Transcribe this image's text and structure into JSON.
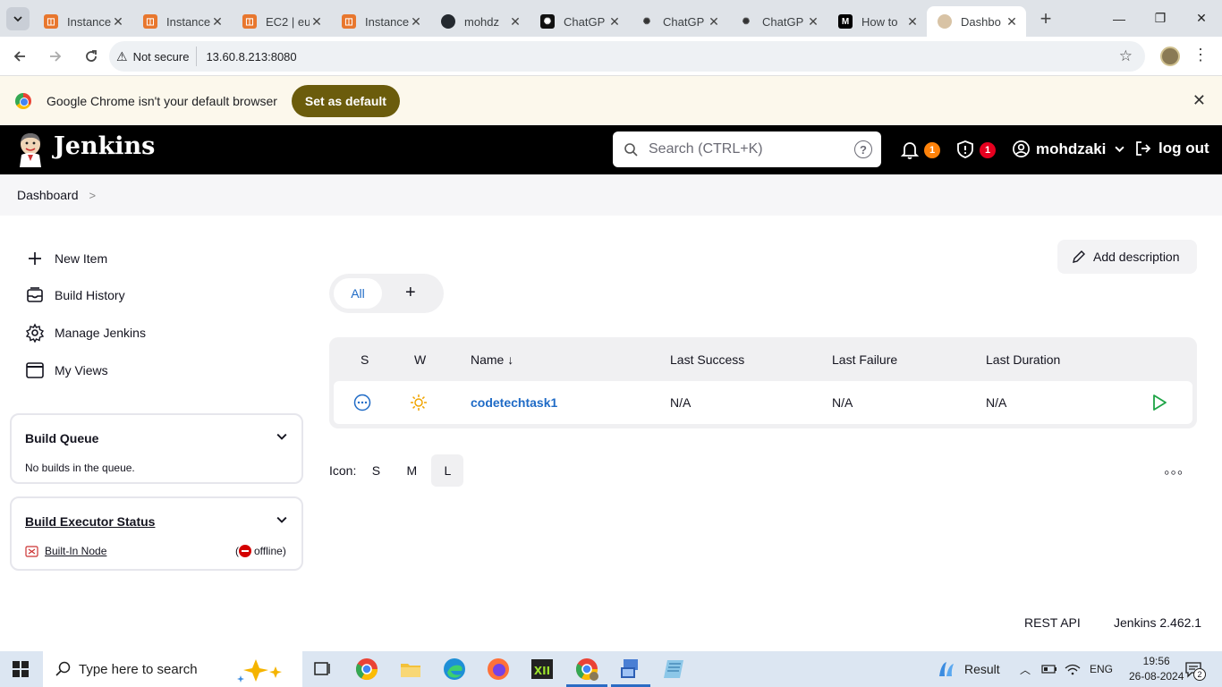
{
  "browser": {
    "tabs": [
      {
        "title": "Instance",
        "icon": "aws-icon"
      },
      {
        "title": "Instance",
        "icon": "aws-icon"
      },
      {
        "title": "EC2 | eu",
        "icon": "aws-icon"
      },
      {
        "title": "Instance",
        "icon": "aws-icon"
      },
      {
        "title": "mohdz",
        "icon": "github-icon"
      },
      {
        "title": "ChatGP",
        "icon": "chatgpt-icon"
      },
      {
        "title": "ChatGP",
        "icon": "chatgpt-icon"
      },
      {
        "title": "ChatGP",
        "icon": "chatgpt-icon"
      },
      {
        "title": "How to",
        "icon": "medium-icon"
      },
      {
        "title": "Dashbo",
        "icon": "jenkins-icon"
      }
    ],
    "security_label": "Not secure",
    "url": "13.60.8.213:8080",
    "infobar_text": "Google Chrome isn't your default browser",
    "set_default_label": "Set as default"
  },
  "header": {
    "title": "Jenkins",
    "search_placeholder": "Search (CTRL+K)",
    "notifications_count": "1",
    "security_count": "1",
    "username": "mohdzaki",
    "logout_label": "log out",
    "colors": {
      "notification_badge": "#fe820a",
      "security_badge": "#e6001f"
    }
  },
  "breadcrumb": {
    "items": [
      "Dashboard"
    ]
  },
  "sidebar": {
    "tasks": [
      {
        "label": "New Item",
        "icon": "plus-icon"
      },
      {
        "label": "Build History",
        "icon": "inbox-icon"
      },
      {
        "label": "Manage Jenkins",
        "icon": "gear-icon"
      },
      {
        "label": "My Views",
        "icon": "window-icon"
      }
    ],
    "build_queue": {
      "title": "Build Queue",
      "empty_text": "No builds in the queue."
    },
    "executor_status": {
      "title": "Build Executor Status",
      "node_name": "Built-In Node",
      "node_status": "offline"
    }
  },
  "main": {
    "add_description_label": "Add description",
    "view_tabs": {
      "all_label": "All",
      "add_label": "+"
    },
    "table": {
      "headers": {
        "status": "S",
        "weather": "W",
        "name": "Name ↓",
        "last_success": "Last Success",
        "last_failure": "Last Failure",
        "last_duration": "Last Duration"
      },
      "rows": [
        {
          "name": "codetechtask1",
          "last_success": "N/A",
          "last_failure": "N/A",
          "last_duration": "N/A"
        }
      ]
    },
    "icon_legend": {
      "label": "Icon:",
      "sizes": [
        "S",
        "M",
        "L"
      ],
      "selected": "L"
    }
  },
  "footer": {
    "rest_api": "REST API",
    "version": "Jenkins 2.462.1"
  },
  "taskbar": {
    "search_placeholder": "Type here to search",
    "weather_text": "Result",
    "language": "ENG",
    "time": "19:56",
    "date": "26-08-2024",
    "notification_count": "2"
  }
}
